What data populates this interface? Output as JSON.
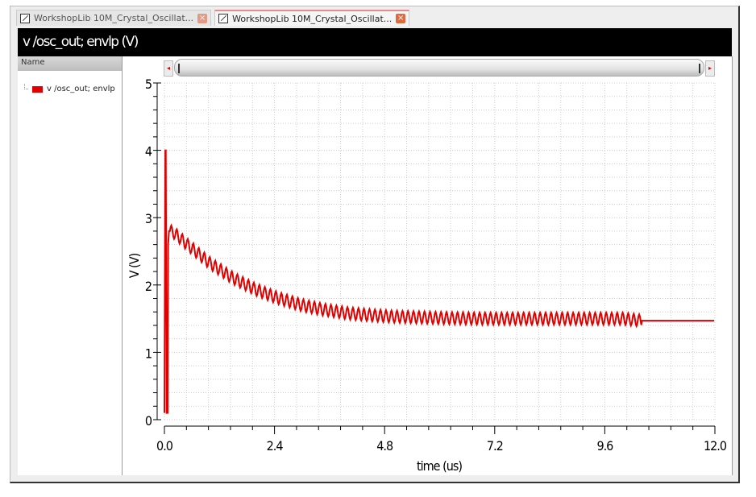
{
  "tabs": [
    {
      "label": "WorkshopLib 10M_Crystal_Oscillat...",
      "active": false,
      "close": "×"
    },
    {
      "label": "WorkshopLib 10M_Crystal_Oscillat...",
      "active": true,
      "close": "×"
    }
  ],
  "title": "v /osc_out; envlp (V)",
  "left_panel": {
    "header": "Name",
    "legend": [
      {
        "label": "v /osc_out; envlp",
        "color": "#e00000"
      }
    ]
  },
  "scrollbar": {
    "left_arrow": "◂",
    "right_arrow": "▸"
  },
  "chart_data": {
    "type": "line",
    "title": "v /osc_out; envlp (V)",
    "xlabel": "time (us)",
    "ylabel": "V (V)",
    "xlim": [
      0,
      12.0
    ],
    "ylim": [
      0,
      5
    ],
    "xticks": [
      "0.0",
      "2.4",
      "4.8",
      "7.2",
      "9.6",
      "12.0"
    ],
    "yticks": [
      "0",
      "1",
      "2",
      "3",
      "4",
      "5"
    ],
    "grid": true,
    "series": [
      {
        "name": "v /osc_out; envlp",
        "color": "#e00000",
        "x": [
          0,
          0.02,
          0.03,
          0.05,
          0.07,
          0.08,
          0.1,
          0.12,
          0.2,
          0.5,
          1.0,
          1.5,
          2.0,
          2.5,
          3.0,
          3.5,
          4.0,
          4.5,
          5.0,
          6.0,
          7.0,
          8.0,
          9.0,
          10.0,
          10.4,
          11.0,
          11.5,
          12.0
        ],
        "y": [
          0.1,
          4.0,
          4.0,
          0.1,
          0.1,
          2.6,
          2.8,
          2.8,
          2.78,
          2.6,
          2.32,
          2.1,
          1.93,
          1.8,
          1.7,
          1.63,
          1.58,
          1.55,
          1.53,
          1.51,
          1.5,
          1.5,
          1.5,
          1.5,
          1.47,
          1.47,
          1.47,
          1.47
        ],
        "ripple_amplitude_v": 0.09,
        "ripple_period_us": 0.12
      }
    ]
  }
}
